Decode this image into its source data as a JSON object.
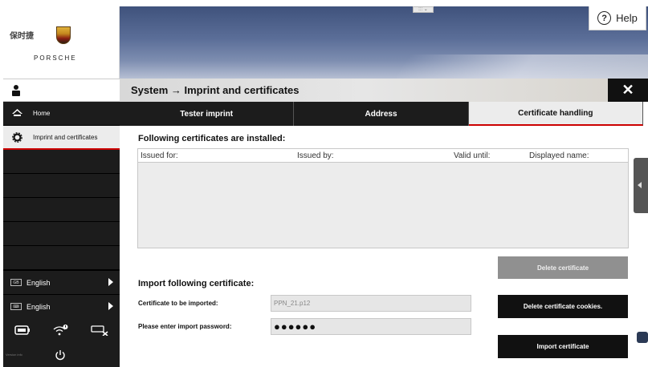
{
  "topbar": {
    "logo_cn": "保时捷",
    "brand": "PORSCHE",
    "drag_handle": "::: ⌄",
    "help_label": "Help",
    "help_icon": "?"
  },
  "header": {
    "title": "System → Imprint and certificates",
    "close_icon": "✕"
  },
  "sidebar": {
    "items": [
      {
        "label": "Home",
        "icon": "home-icon"
      },
      {
        "label": "Imprint and certificates",
        "icon": "gear-icon",
        "active": true
      }
    ],
    "languages": [
      {
        "badge": "GB",
        "label": "English"
      },
      {
        "badge": "⌨",
        "label": "English"
      }
    ],
    "version_text": "Version info"
  },
  "tabs": [
    {
      "label": "Tester imprint"
    },
    {
      "label": "Address"
    },
    {
      "label": "Certificate handling",
      "active": true
    }
  ],
  "content": {
    "installed_heading": "Following certificates are installed:",
    "table_columns": [
      "Issued for:",
      "Issued by:",
      "Valid until:",
      "Displayed name:"
    ],
    "delete_cert_label": "Delete certificate",
    "delete_cookies_label": "Delete certificate cookies.",
    "import_heading": "Import following certificate:",
    "file_label": "Certificate to be imported:",
    "file_value": "PPN_21.p12",
    "password_label": "Please enter import password:",
    "password_value": "●●●●●●",
    "import_label": "Import certificate"
  },
  "colors": {
    "accent_red": "#cc0000",
    "dark": "#1c1c1c"
  }
}
